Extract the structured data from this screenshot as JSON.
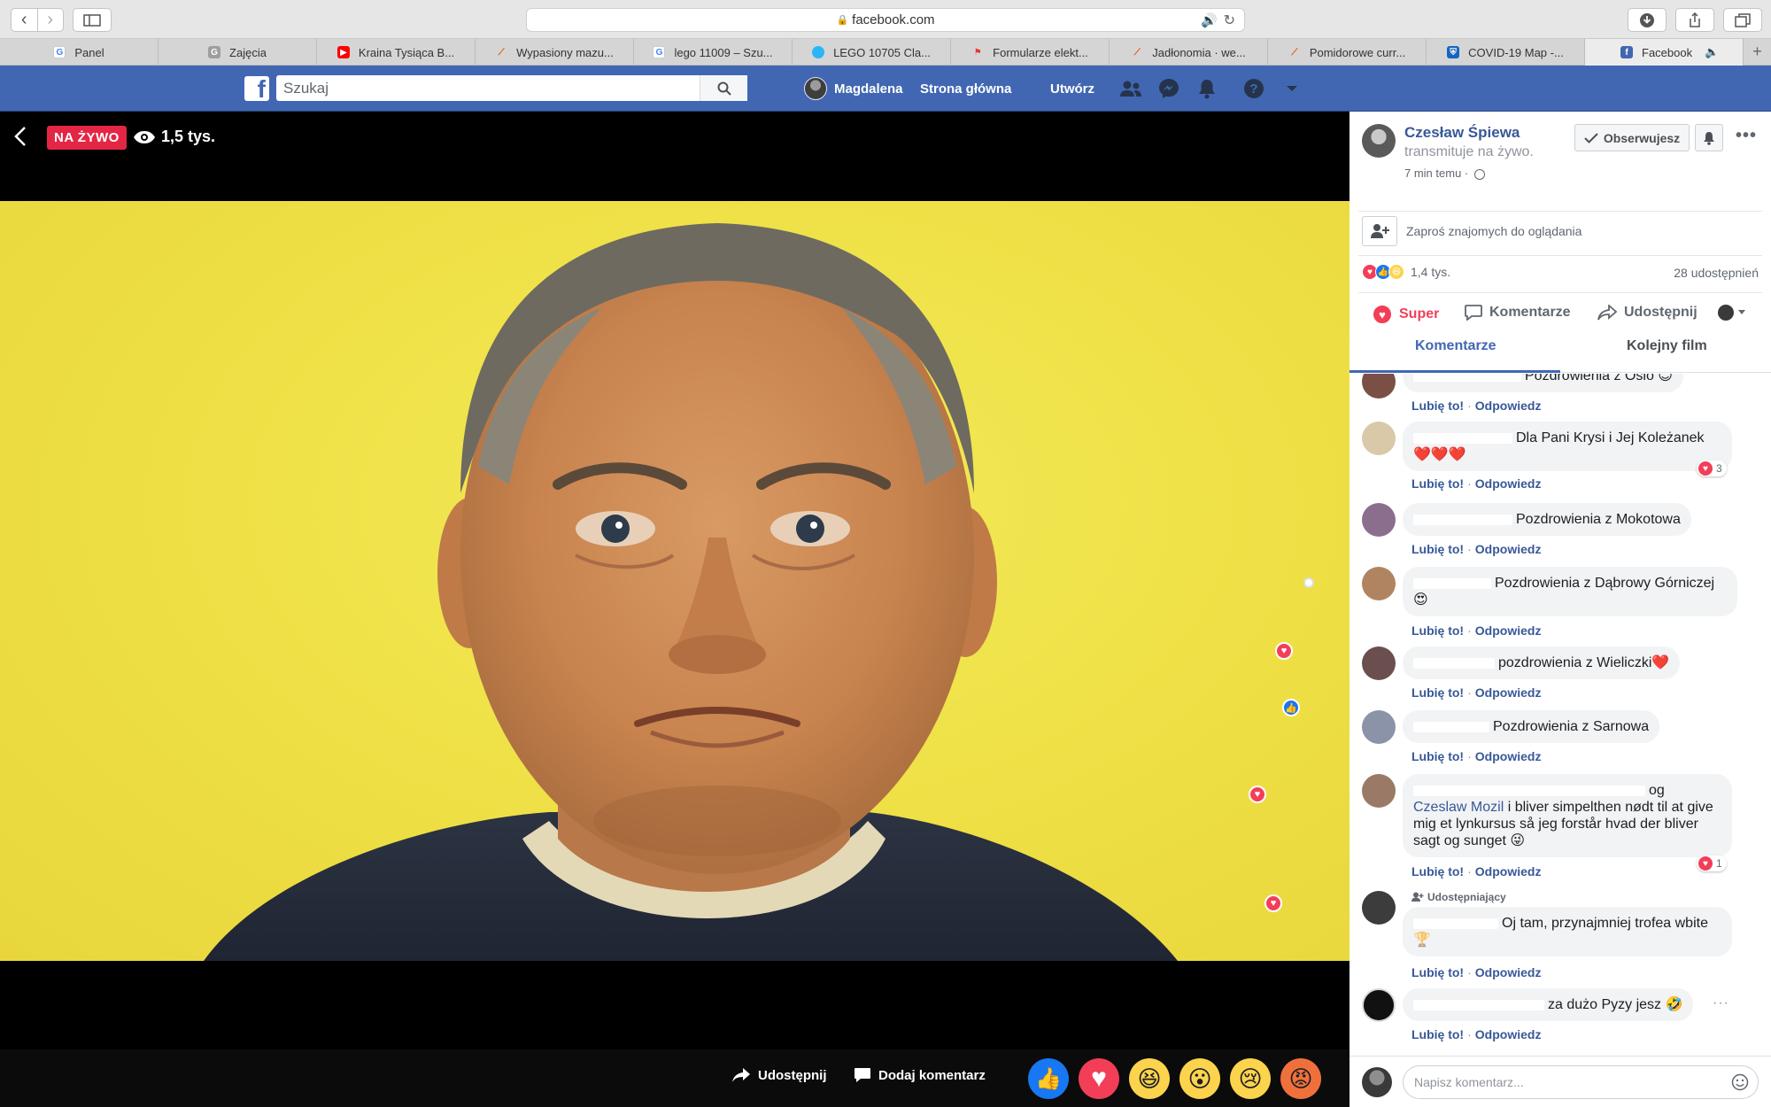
{
  "browser": {
    "url": "facebook.com",
    "tabs": [
      {
        "label": "Panel",
        "icon": "google-icon",
        "color": "#4285f4"
      },
      {
        "label": "Zajęcia",
        "icon": "classroom-icon",
        "color": "#9e9e9e"
      },
      {
        "label": "Kraina Tysiąca B...",
        "icon": "youtube-icon",
        "color": "#ff0000"
      },
      {
        "label": "Wypasiony mazu...",
        "icon": "carrot-icon",
        "color": "#7cb342"
      },
      {
        "label": "lego 11009 – Szu...",
        "icon": "google-icon",
        "color": "#4285f4"
      },
      {
        "label": "LEGO 10705 Cla...",
        "icon": "globe-icon",
        "color": "#29b6f6"
      },
      {
        "label": "Formularze elekt...",
        "icon": "flag-icon",
        "color": "#e53935"
      },
      {
        "label": "Jadłonomia · we...",
        "icon": "carrot-icon",
        "color": "#7cb342"
      },
      {
        "label": "Pomidorowe curr...",
        "icon": "carrot-icon",
        "color": "#7cb342"
      },
      {
        "label": "COVID-19 Map -...",
        "icon": "shield-icon",
        "color": "#1565c0"
      },
      {
        "label": "Facebook",
        "icon": "facebook-icon",
        "color": "#4267b2"
      }
    ]
  },
  "fb": {
    "search_placeholder": "Szukaj",
    "user_name": "Magdalena",
    "nav_home": "Strona główna",
    "nav_create": "Utwórz",
    "brand_color": "#4267b2"
  },
  "video": {
    "live_label": "NA ŻYWO",
    "viewers": "1,5 tys.",
    "share_label": "Udostępnij",
    "comment_label": "Dodaj komentarz",
    "live_color": "#e42645"
  },
  "sidebar": {
    "page_name": "Czesław Śpiewa",
    "page_status": "transmituje na żywo.",
    "time_ago": "7 min temu ·",
    "follow_label": "Obserwujesz",
    "invite_text": "Zaproś znajomych do oglądania",
    "reactions_count": "1,4 tys.",
    "shares_count": "28 udostępnień",
    "action_super": "Super",
    "action_comments": "Komentarze",
    "action_share": "Udostępnij",
    "tab_comments": "Komentarze",
    "tab_next": "Kolejny film",
    "like_label": "Lubię to!",
    "reply_label": "Odpowiedz",
    "write_placeholder": "Napisz komentarz...",
    "author_badge": "Udostępniający"
  },
  "comments": [
    {
      "text": "Pozdrowienia z Oslo 😊",
      "reactions": ""
    },
    {
      "text": "Dla Pani Krysi i Jej Koleżanek",
      "text2": "❤️❤️❤️",
      "reactions": "3"
    },
    {
      "text": "Pozdrowienia z Mokotowa",
      "reactions": ""
    },
    {
      "text": "Pozdrowienia z Dąbrowy Górniczej",
      "text2": "😍",
      "reactions": ""
    },
    {
      "text": "pozdrowienia z Wieliczki❤️",
      "reactions": ""
    },
    {
      "text": "Pozdrowienia z Sarnowa",
      "reactions": ""
    },
    {
      "text": "og",
      "mention": "Czeslaw Mozil",
      "text2": " i bliver simpelthen nødt til at give mig et lynkursus så jeg forstår hvad der bliver sagt og sunget 😜",
      "reactions": "1"
    },
    {
      "text": "Oj tam, przynajmniej trofea wbite",
      "text2": "🏆",
      "reactions": ""
    },
    {
      "text": "za dużo Pyzy jesz 🤣",
      "reactions": ""
    }
  ]
}
